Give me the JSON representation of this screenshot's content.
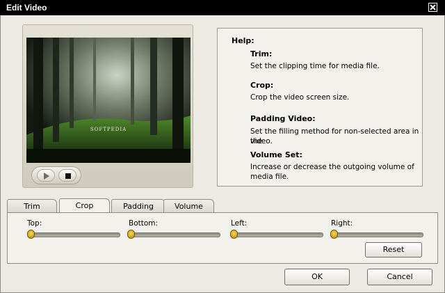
{
  "window": {
    "title": "Edit Video"
  },
  "preview": {
    "watermark": "SOFTPEDIA"
  },
  "help": {
    "heading": "Help:",
    "sections": [
      {
        "title": "Trim:",
        "text": "Set the clipping time for media file."
      },
      {
        "title": "Crop:",
        "text": "Crop the video screen size."
      },
      {
        "title": "Padding Video:",
        "text_line1": "Set the filling method for non-selected area in the",
        "text_line2": "video."
      },
      {
        "title": "Volume Set:",
        "text_line1": "Increase or decrease the outgoing volume of",
        "text_line2": "media file."
      }
    ]
  },
  "tabs": [
    {
      "label": "Trim",
      "active": false
    },
    {
      "label": "Crop",
      "active": true
    },
    {
      "label": "Padding",
      "active": false
    },
    {
      "label": "Volume",
      "active": false
    }
  ],
  "crop": {
    "sliders": [
      {
        "label": "Top:",
        "value": 0
      },
      {
        "label": "Bottom:",
        "value": 0
      },
      {
        "label": "Left:",
        "value": 0
      },
      {
        "label": "Right:",
        "value": 0
      }
    ],
    "reset_label": "Reset"
  },
  "footer": {
    "ok_label": "OK",
    "cancel_label": "Cancel"
  },
  "colors": {
    "titlebar": "#000000",
    "window_bg": "#eceae2",
    "thumb": "#e3b52a"
  }
}
